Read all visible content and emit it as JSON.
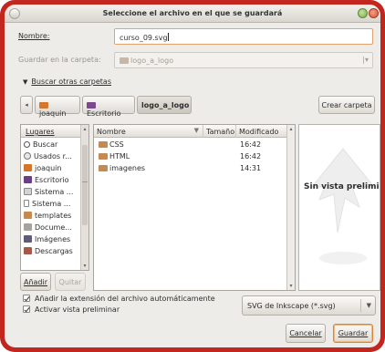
{
  "dialog": {
    "title": "Seleccione el archivo en el que se guardará"
  },
  "name_row": {
    "label": "Nombre:",
    "value": "curso_09.svg"
  },
  "folder_row": {
    "label": "Guardar en la carpeta:",
    "value": "logo_a_logo"
  },
  "browse": {
    "label": "Buscar otras carpetas"
  },
  "pathbar": {
    "crumbs": [
      "joaquin",
      "Escritorio",
      "logo_a_logo"
    ],
    "create_folder": "Crear carpeta"
  },
  "places": {
    "header": "Lugares",
    "items": [
      {
        "label": "Buscar",
        "icon": "search-icon"
      },
      {
        "label": "Usados r...",
        "icon": "clock-icon"
      },
      {
        "label": "joaquin",
        "icon": "home-folder-icon"
      },
      {
        "label": "Escritorio",
        "icon": "desktop-icon"
      },
      {
        "label": "Sistema ...",
        "icon": "drive-icon"
      },
      {
        "label": "Sistema ...",
        "icon": "usb-drive-icon"
      },
      {
        "label": "templates",
        "icon": "folder-icon"
      },
      {
        "label": "Docume...",
        "icon": "documents-folder-icon"
      },
      {
        "label": "Imágenes",
        "icon": "pictures-folder-icon"
      },
      {
        "label": "Descargas",
        "icon": "downloads-folder-icon"
      }
    ],
    "add_button": "Añadir",
    "remove_button": "Quitar"
  },
  "files": {
    "columns": {
      "name": "Nombre",
      "size": "Tamaño",
      "modified": "Modificado"
    },
    "rows": [
      {
        "name": "CSS",
        "modified": "16:42"
      },
      {
        "name": "HTML",
        "modified": "16:42"
      },
      {
        "name": "imagenes",
        "modified": "14:31"
      }
    ]
  },
  "preview": {
    "text": "Sin vista prelimin"
  },
  "options": {
    "auto_extension": "Añadir la extensión del archivo automáticamente",
    "preview": "Activar vista preliminar"
  },
  "filter": {
    "value": "SVG de Inkscape (*.svg)"
  },
  "actions": {
    "cancel": "Cancelar",
    "save": "Guardar"
  },
  "colors": {
    "frame": "#c2261e",
    "accent": "#d9843c",
    "folder": "#c48a52"
  }
}
